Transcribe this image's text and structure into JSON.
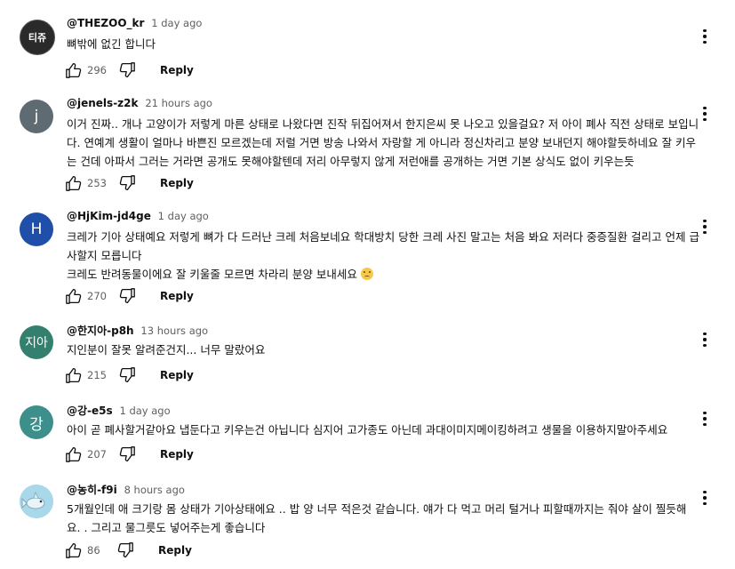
{
  "comments": [
    {
      "author": "@THEZOO_kr",
      "time": "1 day ago",
      "avatar": {
        "text": "티쥬",
        "color": "#2a2a2a"
      },
      "lines": [
        "뼈밖에 없긴 합니다"
      ],
      "likes": "296",
      "reply": "Reply"
    },
    {
      "author": "@jenels-z2k",
      "time": "21 hours ago",
      "avatar": {
        "text": "j",
        "color": "#5f6b72"
      },
      "lines": [
        "이거 진짜.. 개나 고양이가 저렇게 마른 상태로 나왔다면 진작 뒤집어져서 한지은씨 못 나오고 있을걸요? 저 아이 폐사 직전 상태로 보입니다. 연예계 생활이 얼마나 바쁜진 모르겠는데 저럴 거면 방송 나와서 자랑할 게 아니라 정신차리고 분양 보내던지 해야할듯하네요 잘 키우는 건데 아파서 그러는 거라면 공개도 못해야할텐데 저리 아무렇지 않게 저런애를 공개하는 거면 기본 상식도 없이 키우는듯"
      ],
      "likes": "253",
      "reply": "Reply"
    },
    {
      "author": "@HjKim-jd4ge",
      "time": "1 day ago",
      "avatar": {
        "text": "H",
        "color": "#1f4fa8"
      },
      "lines": [
        "크레가 기아 상태예요 저렇게 뼈가 다 드러난 크레 처음보네요 학대방치 당한 크레 사진 말고는 처음 봐요 저러다 중증질환 걸리고 언제 급사할지 모릅니다",
        "크레도 반려동물이에요 잘 키울줄 모르면 차라리 분양 보내세요"
      ],
      "likes": "270",
      "reply": "Reply"
    },
    {
      "author": "@한지아-p8h",
      "time": "13 hours ago",
      "avatar": {
        "text": "지아",
        "color": "#33806f"
      },
      "lines": [
        "지인분이 잘못 알려준건지... 너무 말랐어요"
      ],
      "likes": "215",
      "reply": "Reply"
    },
    {
      "author": "@강-e5s",
      "time": "1 day ago",
      "avatar": {
        "text": "강",
        "color": "#3c8f8a"
      },
      "lines": [
        "아이 곧 폐사할거같아요 냅둔다고 키우는건 아닙니다 심지어 고가종도 아닌데 과대이미지메이킹하려고 생물을 이용하지말아주세요"
      ],
      "likes": "207",
      "reply": "Reply"
    },
    {
      "author": "@농히-f9i",
      "time": "8 hours ago",
      "avatar": {
        "text": "",
        "color": "#9fd3e8"
      },
      "lines": [
        "5개월인데 애 크기랑 몸 상태가 기아상태에요 ..  밥 양 너무 적은것 같습니다. 얘가 다 먹고 머리 털거나 피할때까지는 줘야  살이 찔듯해요. . 그리고 물그릇도 넣어주는게 좋습니다"
      ],
      "likes": "86",
      "reply": "Reply"
    }
  ],
  "icons": {
    "like": "thumbs-up-icon",
    "dislike": "thumbs-down-icon",
    "menu": "more-vert-icon",
    "emoji": "sad-face-emoji"
  }
}
